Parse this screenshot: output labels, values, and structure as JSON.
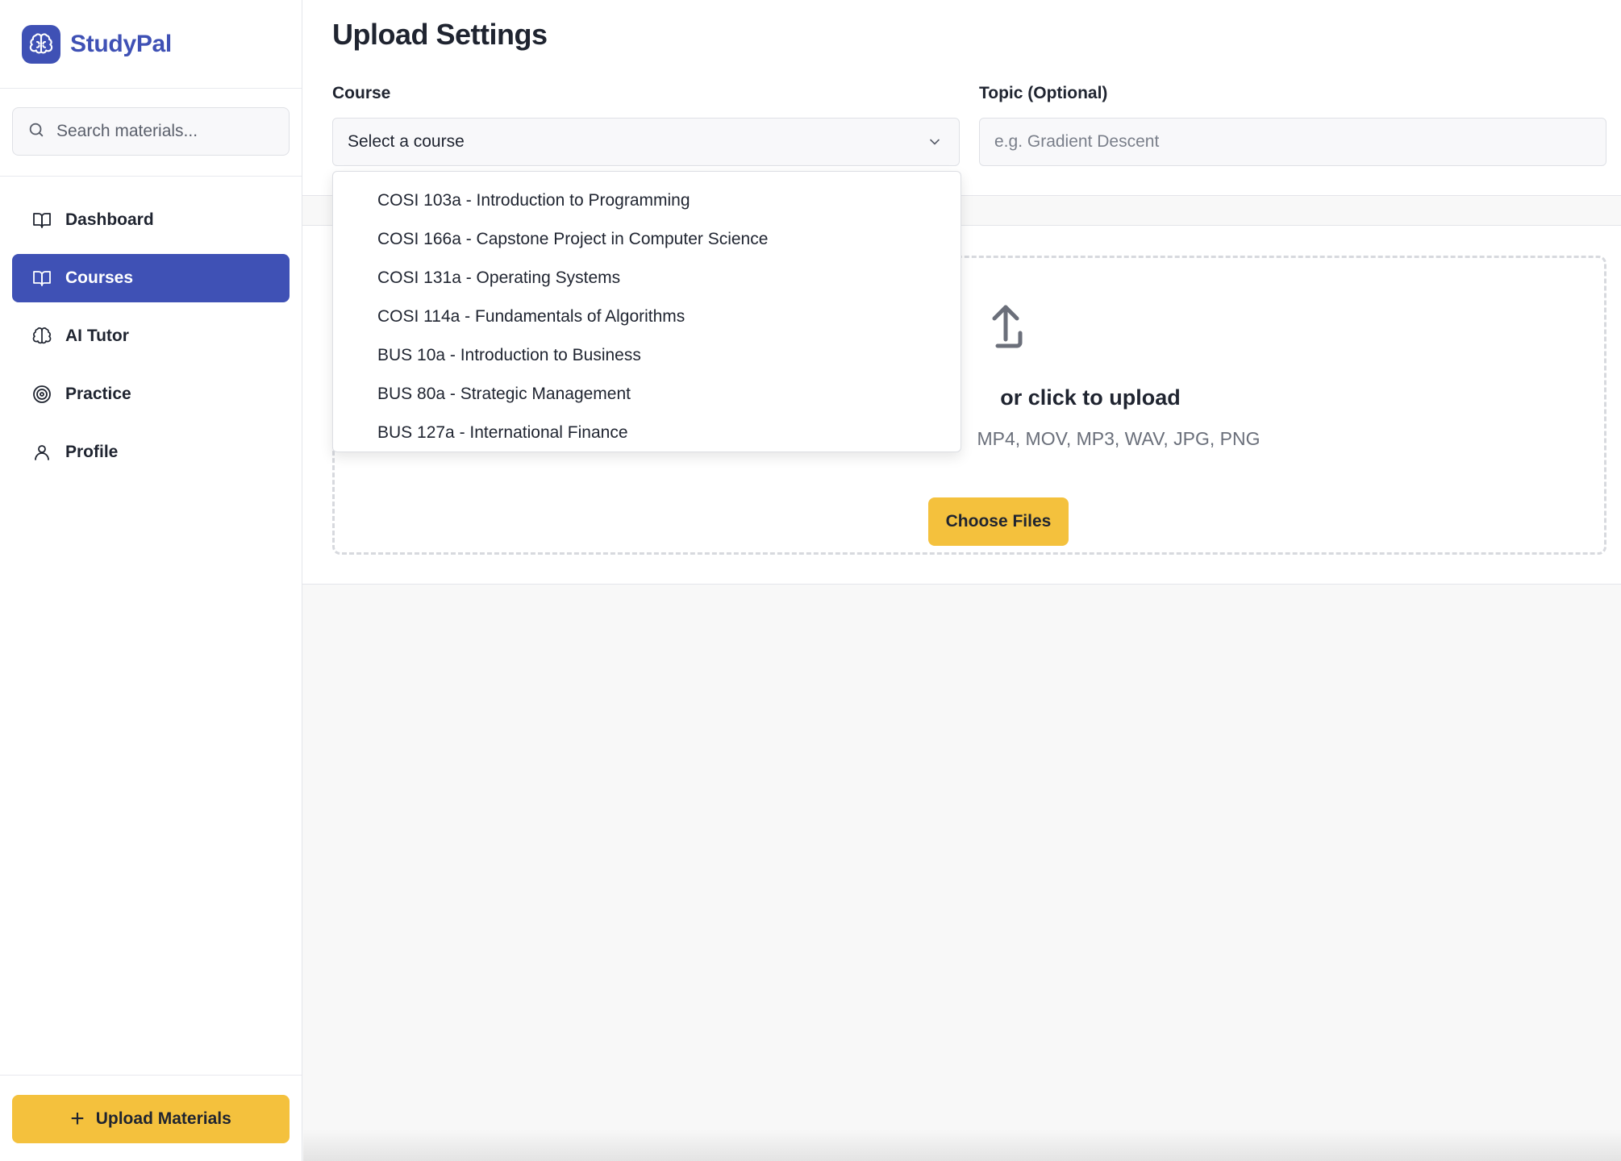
{
  "brand": {
    "name": "StudyPal",
    "accent": "#3f51b5"
  },
  "sidebar": {
    "search_placeholder": "Search materials...",
    "items": [
      {
        "label": "Dashboard",
        "icon": "book-open-icon",
        "active": false
      },
      {
        "label": "Courses",
        "icon": "book-open-icon",
        "active": true
      },
      {
        "label": "AI Tutor",
        "icon": "brain-icon",
        "active": false
      },
      {
        "label": "Practice",
        "icon": "target-icon",
        "active": false
      },
      {
        "label": "Profile",
        "icon": "user-icon",
        "active": false
      }
    ],
    "upload_button": "Upload Materials"
  },
  "upload_settings": {
    "title": "Upload Settings",
    "course_label": "Course",
    "course_selected": "Select a course",
    "topic_label": "Topic (Optional)",
    "topic_placeholder": "e.g. Gradient Descent",
    "course_options": [
      "COSI 103a - Introduction to Programming",
      "COSI 166a - Capstone Project in Computer Science",
      "COSI 131a - Operating Systems",
      "COSI 114a - Fundamentals of Algorithms",
      "BUS 10a - Introduction to Business",
      "BUS 80a - Strategic Management",
      "BUS 127a - International Finance"
    ]
  },
  "dropzone": {
    "title": "or click to upload",
    "formats": "MP4, MOV, MP3, WAV, JPG, PNG",
    "button": "Choose Files",
    "button_color": "#f4c13d"
  }
}
